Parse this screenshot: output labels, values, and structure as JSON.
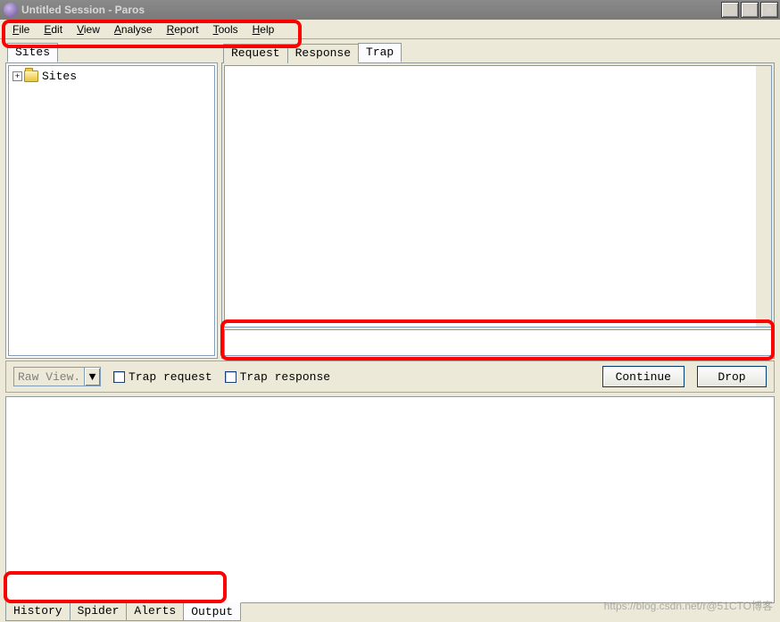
{
  "window": {
    "title": "Untitled Session - Paros",
    "buttons": {
      "min": "_",
      "max": "□",
      "close": "×"
    }
  },
  "menu": {
    "items": [
      {
        "label": "File",
        "accel": "F"
      },
      {
        "label": "Edit",
        "accel": "E"
      },
      {
        "label": "View",
        "accel": "V"
      },
      {
        "label": "Analyse",
        "accel": "A"
      },
      {
        "label": "Report",
        "accel": "R"
      },
      {
        "label": "Tools",
        "accel": "T"
      },
      {
        "label": "Help",
        "accel": "H"
      }
    ]
  },
  "left": {
    "tab_label": "Sites",
    "tree_root_label": "Sites"
  },
  "right": {
    "tabs": {
      "request": "Request",
      "response": "Response",
      "trap": "Trap"
    },
    "controls": {
      "view_combo_value": "Raw View...",
      "trap_request_label": "Trap request",
      "trap_response_label": "Trap response",
      "continue_label": "Continue",
      "drop_label": "Drop"
    }
  },
  "bottom": {
    "tabs": {
      "history": "History",
      "spider": "Spider",
      "alerts": "Alerts",
      "output": "Output"
    }
  },
  "watermark": "https://blog.csdn.net/r@51CTO博客"
}
